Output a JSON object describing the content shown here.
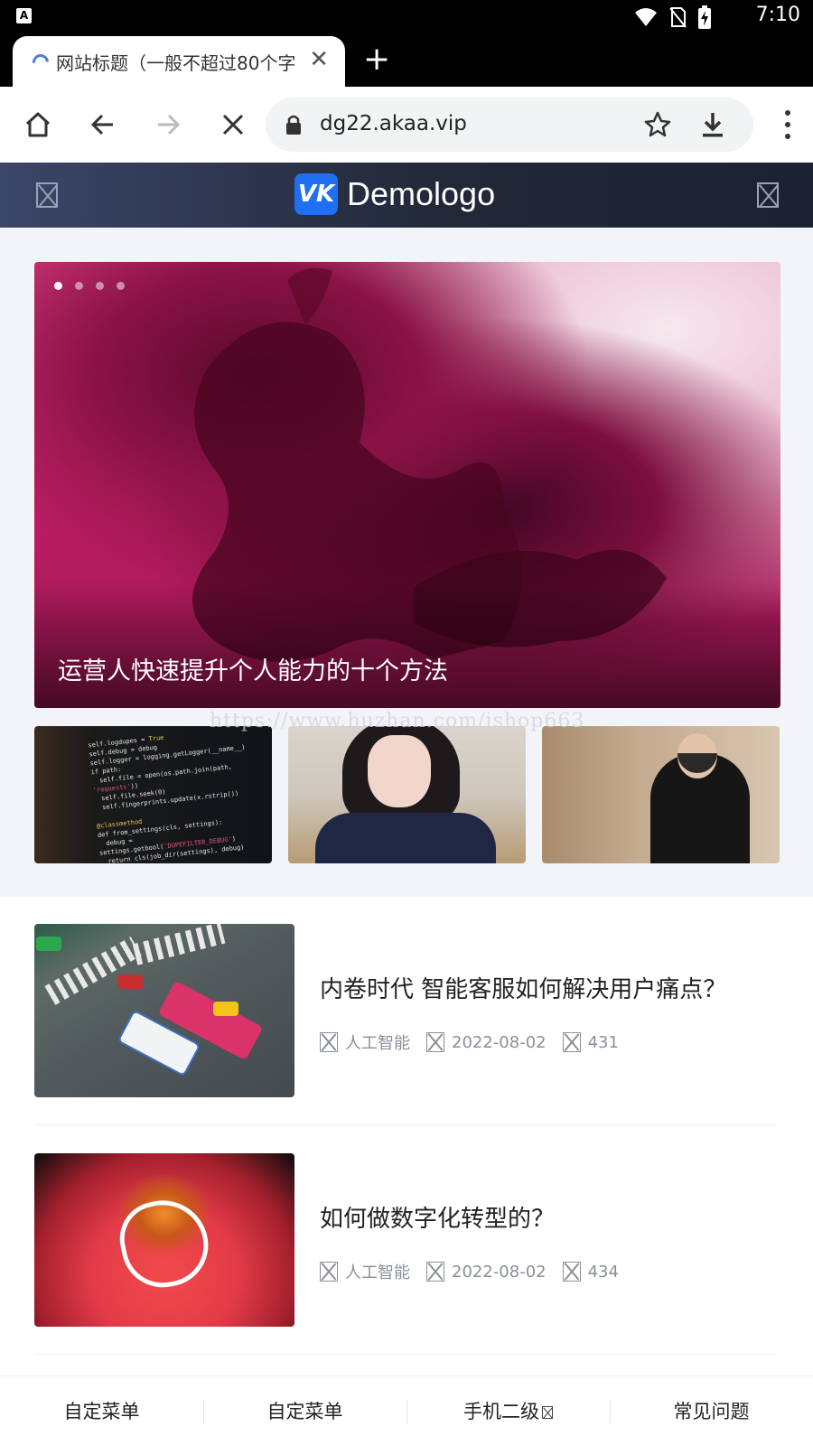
{
  "status_bar": {
    "time": "7:10",
    "app_icon_label": "A"
  },
  "browser": {
    "tab_title": "网站标题（一般不超过80个字",
    "url": "dg22.akaa.vip"
  },
  "site": {
    "logo_mark": "VK",
    "logo_text": "Demologo"
  },
  "banner": {
    "caption": "运营人快速提升个人能力的十个方法",
    "slide_count": 4,
    "active_slide": 1
  },
  "watermark": "https://www.huzhan.com/ishop663",
  "articles": [
    {
      "title": "内卷时代 智能客服如何解决用户痛点？",
      "category": "人工智能",
      "date": "2022-08-02",
      "views": "431"
    },
    {
      "title": "如何做数字化转型的？",
      "category": "人工智能",
      "date": "2022-08-02",
      "views": "434"
    }
  ],
  "bottom_nav": [
    {
      "label": "自定菜单"
    },
    {
      "label": "自定菜单"
    },
    {
      "label": "手机二级"
    },
    {
      "label": "常见问题"
    }
  ],
  "colors": {
    "header_bg": "#222838",
    "logo_blue": "#1f6ff2",
    "banner_pink": "#c21f66",
    "meta_gray": "#8a8f99"
  }
}
